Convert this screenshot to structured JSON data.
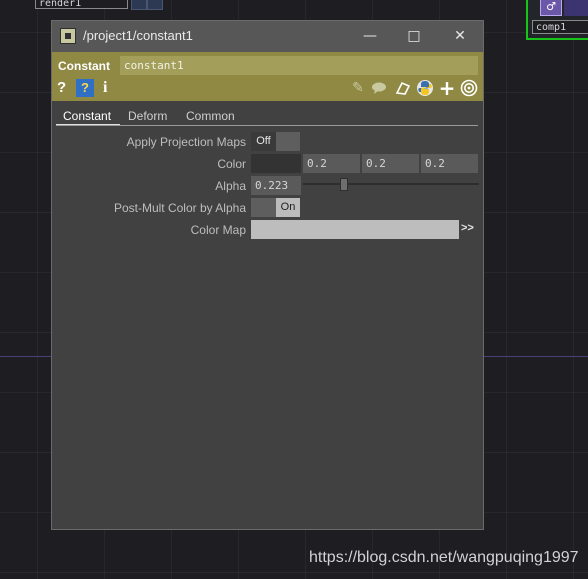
{
  "background": {
    "nodes": [
      {
        "name": "render1"
      },
      {
        "name": "comp1",
        "badge": "♂"
      }
    ],
    "watermark": "https://blog.csdn.net/wangpuqing1997"
  },
  "window": {
    "title": "/project1/constant1",
    "controls": {
      "minimize": "—",
      "maximize": "□",
      "close": "✕"
    }
  },
  "operator": {
    "type": "Constant",
    "name": "constant1",
    "icons": [
      "help-icon",
      "python-help-icon",
      "info-icon",
      "edit-icon",
      "comment-icon",
      "clone-icon",
      "python-icon",
      "add-icon",
      "target-icon"
    ]
  },
  "tabs": [
    {
      "label": "Constant",
      "active": true
    },
    {
      "label": "Deform",
      "active": false
    },
    {
      "label": "Common",
      "active": false
    }
  ],
  "params": {
    "apply_projection_maps": {
      "label": "Apply Projection Maps",
      "value": "Off"
    },
    "color": {
      "label": "Color",
      "r": "0.2",
      "g": "0.2",
      "b": "0.2"
    },
    "alpha": {
      "label": "Alpha",
      "value": "0.223"
    },
    "post_mult": {
      "label": "Post-Mult Color by Alpha",
      "value": "On"
    },
    "color_map": {
      "label": "Color Map",
      "value": "",
      "expand": ">>"
    }
  },
  "colors": {
    "accent": "#8f8943",
    "node_selected_border": "#19c419"
  }
}
